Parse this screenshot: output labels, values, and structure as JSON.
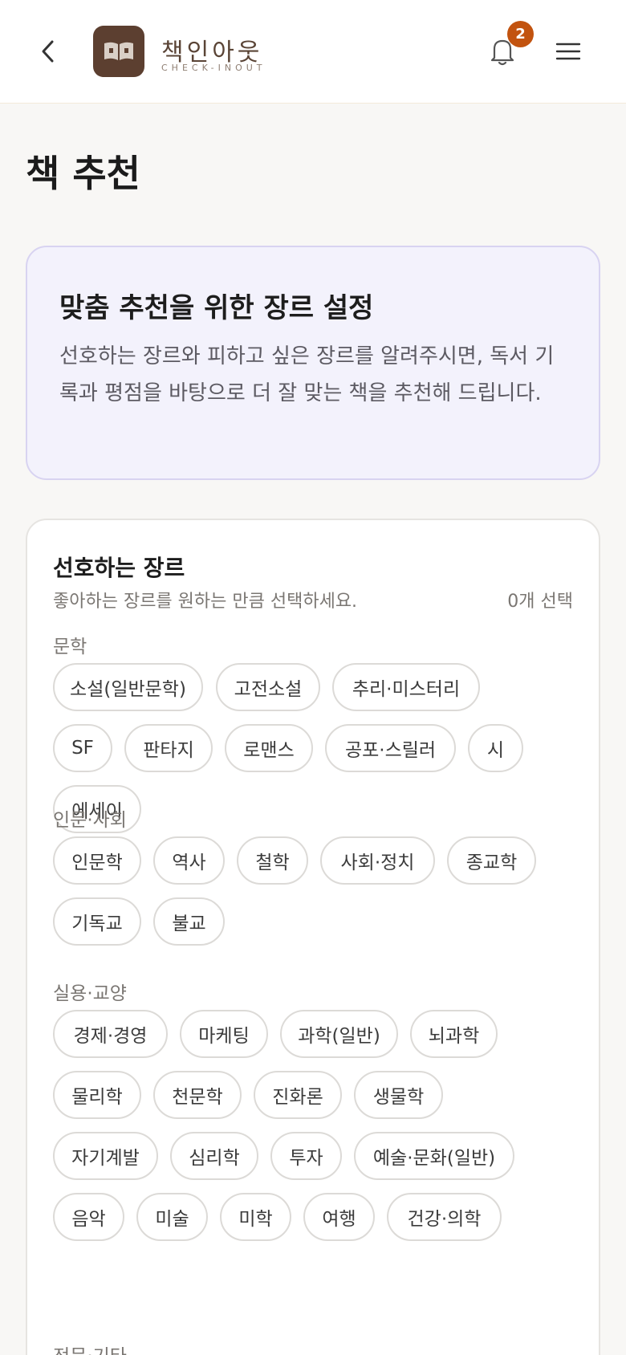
{
  "header": {
    "brand_name": "책인아웃",
    "brand_sub": "CHECK-INOUT",
    "notification_count": "2"
  },
  "page": {
    "title": "책 추천"
  },
  "info_card": {
    "title": "맞춤 추천을 위한 장르 설정",
    "description": "선호하는 장르와 피하고 싶은 장르를 알려주시면, 독서 기록과 평점을 바탕으로 더 잘 맞는 책을 추천해 드립니다."
  },
  "preferred": {
    "title": "선호하는 장르",
    "subtitle": "좋아하는 장르를 원하는 만큼 선택하세요.",
    "count": "0개 선택",
    "categories": [
      {
        "label": "문학",
        "genres": [
          "소설(일반문학)",
          "고전소설",
          "추리·미스터리",
          "SF",
          "판타지",
          "로맨스",
          "공포·스릴러",
          "시",
          "에세이"
        ]
      },
      {
        "label": "인문·사회",
        "genres": [
          "인문학",
          "역사",
          "철학",
          "사회·정치",
          "종교학",
          "기독교",
          "불교"
        ]
      },
      {
        "label": "실용·교양",
        "genres": [
          "경제·경영",
          "마케팅",
          "과학(일반)",
          "뇌과학",
          "물리학",
          "천문학",
          "진화론",
          "생물학",
          "자기계발",
          "심리학",
          "투자",
          "예술·문화(일반)",
          "음악",
          "미술",
          "미학",
          "여행",
          "건강·의학"
        ]
      },
      {
        "label": "전문·기타",
        "genres": []
      }
    ]
  },
  "colors": {
    "brand": "#5c3f30",
    "badge": "#c2530f",
    "info_bg": "#f3f2fc",
    "info_border": "#d8d3f1"
  },
  "icons": {
    "back": "chevron-left-icon",
    "logo": "open-book-icon",
    "bell": "bell-icon",
    "menu": "hamburger-menu-icon"
  }
}
